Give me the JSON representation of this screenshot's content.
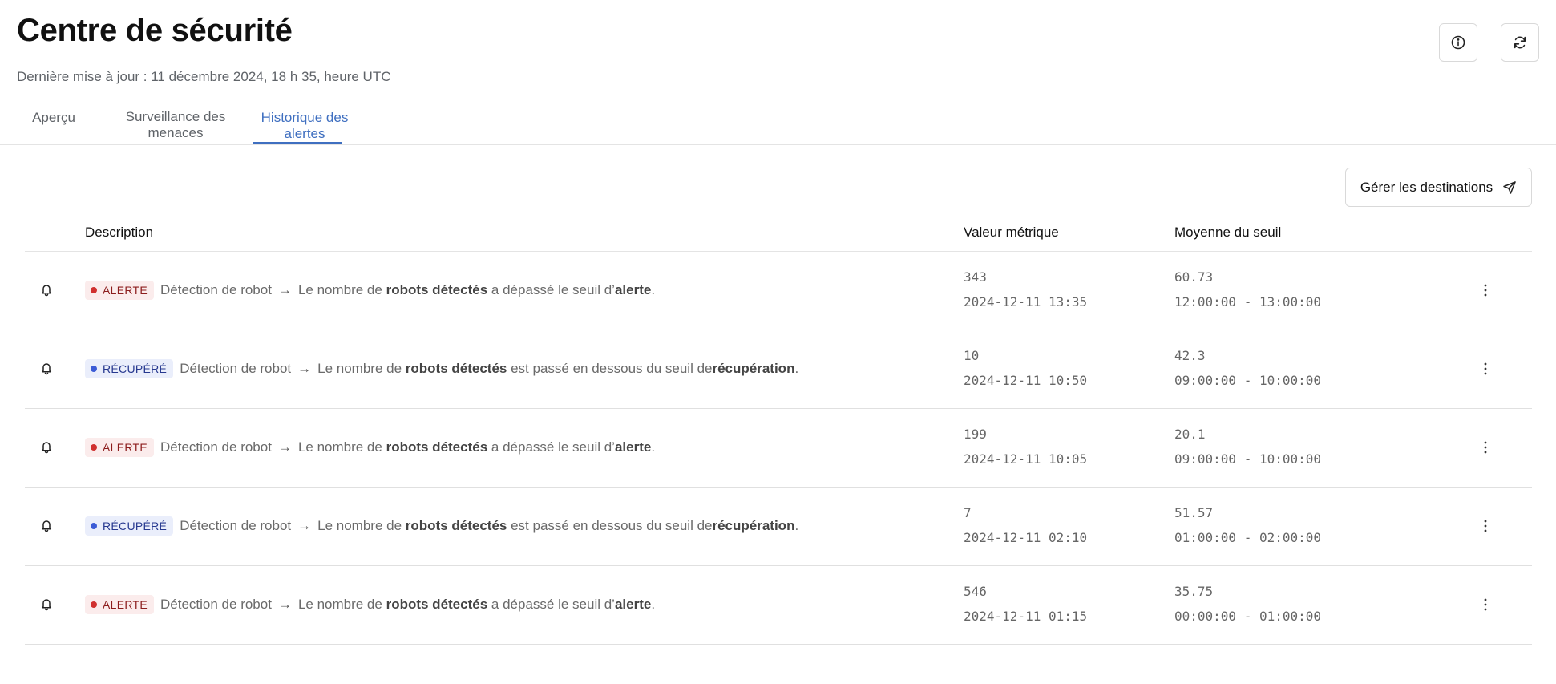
{
  "header": {
    "title": "Centre de sécurité",
    "subtitle": "Dernière mise à jour : 11 décembre 2024, 18 h 35, heure UTC",
    "info_icon": "info-icon",
    "refresh_icon": "refresh-icon"
  },
  "tabs": [
    {
      "label": "Aperçu",
      "active": false
    },
    {
      "label_line1": "Surveillance des",
      "label_line2": "menaces",
      "active": false
    },
    {
      "label_line1": "Historique des",
      "label_line2": "alertes",
      "active": true
    }
  ],
  "accent_color": "#3f6fc0",
  "destinations_button": {
    "label": "Gérer les destinations",
    "icon": "send-icon"
  },
  "table": {
    "columns": [
      "Description",
      "Valeur métrique",
      "Moyenne du seuil"
    ],
    "rows": [
      {
        "status": "ALERTE",
        "status_type": "alert",
        "source": "Détection de robot",
        "text_a": "Le nombre de",
        "metric_name": "robots détectés",
        "text_b": "a dépassé le seuil d’",
        "threshold_name": "alerte",
        "end": ".",
        "metric_value": "343",
        "metric_time": "2024-12-11 13:35",
        "threshold_avg": "60.73",
        "threshold_range": "12:00:00 - 13:00:00"
      },
      {
        "status": "RÉCUPÉRÉ",
        "status_type": "recovered",
        "source": "Détection de robot",
        "text_a": "Le nombre de",
        "metric_name": "robots détectés",
        "text_b": "est passé en dessous du seuil de",
        "threshold_name": "récupération",
        "end": ".",
        "metric_value": "10",
        "metric_time": "2024-12-11 10:50",
        "threshold_avg": "42.3",
        "threshold_range": "09:00:00 - 10:00:00"
      },
      {
        "status": "ALERTE",
        "status_type": "alert",
        "source": "Détection de robot",
        "text_a": "Le nombre de",
        "metric_name": "robots détectés",
        "text_b": "a dépassé le seuil d’",
        "threshold_name": "alerte",
        "end": ".",
        "metric_value": "199",
        "metric_time": "2024-12-11 10:05",
        "threshold_avg": "20.1",
        "threshold_range": "09:00:00 - 10:00:00"
      },
      {
        "status": "RÉCUPÉRÉ",
        "status_type": "recovered",
        "source": "Détection de robot",
        "text_a": "Le nombre de",
        "metric_name": "robots détectés",
        "text_b": "est passé en dessous du seuil de",
        "threshold_name": "récupération",
        "end": ".",
        "metric_value": "7",
        "metric_time": "2024-12-11 02:10",
        "threshold_avg": "51.57",
        "threshold_range": "01:00:00 - 02:00:00"
      },
      {
        "status": "ALERTE",
        "status_type": "alert",
        "source": "Détection de robot",
        "text_a": "Le nombre de",
        "metric_name": "robots détectés",
        "text_b": "a dépassé le seuil d’",
        "threshold_name": "alerte",
        "end": ".",
        "metric_value": "546",
        "metric_time": "2024-12-11 01:15",
        "threshold_avg": "35.75",
        "threshold_range": "00:00:00 - 01:00:00"
      }
    ]
  }
}
